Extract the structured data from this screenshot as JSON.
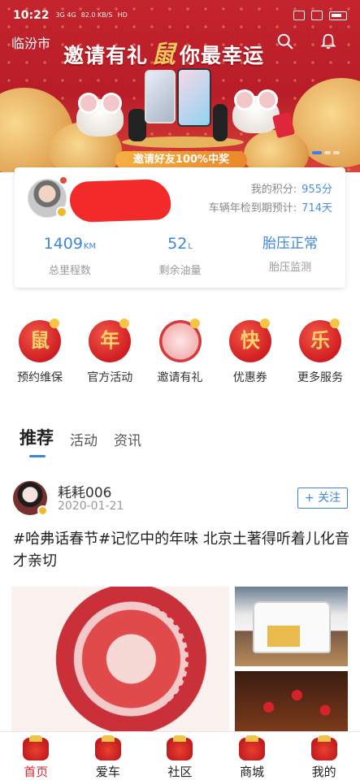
{
  "status_bar": {
    "time": "10:22",
    "network": "3G 4G",
    "speed": "82.0 KB/S",
    "hd": "HD"
  },
  "banner": {
    "city": "临汾市",
    "title_part1": "邀请有礼",
    "title_highlight": "鼠",
    "title_part2": "你最幸运",
    "pill_text": "邀请好友100%中奖"
  },
  "profile": {
    "points_label": "我的积分:",
    "points_value": "955分",
    "inspection_label": "车辆年检到期预计:",
    "inspection_value": "714天",
    "stats": [
      {
        "value": "1409",
        "unit": "KM",
        "label": "总里程数"
      },
      {
        "value": "52",
        "unit": "L",
        "label": "剩余油量"
      },
      {
        "value": "胎压正常",
        "unit": "",
        "label": "胎压监测"
      }
    ]
  },
  "services": [
    {
      "glyph": "鼠",
      "label": "预约维保"
    },
    {
      "glyph": "年",
      "label": "官方活动"
    },
    {
      "glyph": "",
      "label": "邀请有礼"
    },
    {
      "glyph": "快",
      "label": "优惠券"
    },
    {
      "glyph": "乐",
      "label": "更多服务"
    }
  ],
  "tabs": [
    "推荐",
    "活动",
    "资讯"
  ],
  "post": {
    "username": "耗耗006",
    "date": "2020-01-21",
    "follow_label": "+ 关注",
    "text": "#哈弗话春节#记忆中的年味 北京土著得听着儿化音才亲切"
  },
  "bottom_nav": [
    "首页",
    "爱车",
    "社区",
    "商城",
    "我的"
  ],
  "colors": {
    "accent": "#3e86d8",
    "brand_red": "#e0262e"
  }
}
